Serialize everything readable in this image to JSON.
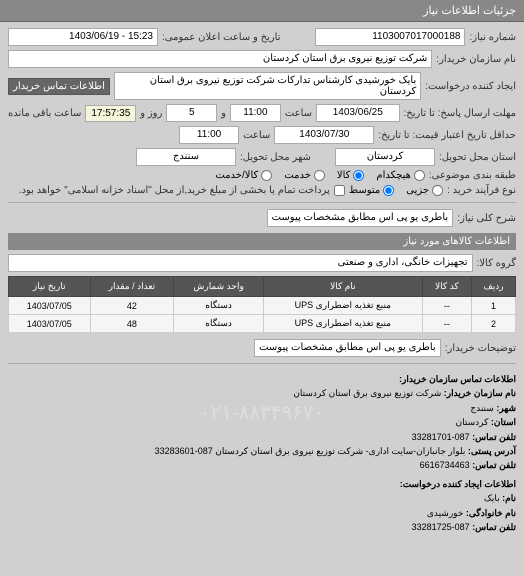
{
  "header": {
    "title": "جزئیات اطلاعات نیاز"
  },
  "fields": {
    "request_number_label": "شماره نیاز:",
    "request_number": "1103007017000188",
    "public_datetime_label": "تاریخ و ساعت اعلان عمومی:",
    "public_datetime": "15:23 - 1403/06/19",
    "buyer_name_label": "نام سازمان خریدار:",
    "buyer_name": "شرکت توزیع نیروی برق استان کردستان",
    "request_creator_label": "ایجاد کننده درخواست:",
    "request_creator": "بایک خورشیدی کارشناس تدارکات شرکت توزیع نیروی برق استان کردستان",
    "buyer_contact_btn": "اطلاعات تماس خریدار",
    "response_deadline_label": "مهلت ارسال پاسخ: تا تاریخ:",
    "response_date": "1403/06/25",
    "response_time_label": "ساعت",
    "response_time": "11:00",
    "remaining_label": "و",
    "remaining_days": "5",
    "remaining_days_label": "روز و",
    "remaining_time": "17:57:35",
    "remaining_time_label": "ساعت باقی مانده",
    "credit_deadline_label": "حداقل تاریخ اعتبار قیمت: تا تاریخ:",
    "credit_date": "1403/07/30",
    "credit_time_label": "ساعت",
    "credit_time": "11:00",
    "province_label": "استان محل تحویل:",
    "province": "کردستان",
    "city_label": "شهر محل تحویل:",
    "city": "سنندج",
    "classification_label": "طبقه بندی موضوعی:",
    "classification_none": "هیچکدام",
    "classification_goods": "کالا",
    "classification_service": "خدمت",
    "classification_goods_service": "کالا/خدمت",
    "process_type_label": "نوع فرآیند خرید :",
    "process_small": "جزیی",
    "process_medium": "متوسط",
    "process_note": "پرداخت تمام یا بخشی از مبلغ خرید,از محل \"اسناد خزانه اسلامی\" خواهد بود.",
    "general_desc_label": "شرح کلی نیاز:",
    "general_desc": "باطری یو پی اس مطابق مشخصات پیوست",
    "goods_info_title": "اطلاعات کالاهای مورد نیاز",
    "goods_group_label": "گروه کالا:",
    "goods_group": "تجهیزات خانگی، اداری و صنعتی",
    "buyer_note_label": "توضیحات خریدار:",
    "buyer_note": "باطری یو پی اس مطابق مشخصات پیوست"
  },
  "table": {
    "headers": {
      "row": "ردیف",
      "code": "کد کالا",
      "name": "نام کالا",
      "unit": "واحد شمارش",
      "qty": "تعداد / مقدار",
      "date": "تاریخ نیاز"
    },
    "rows": [
      {
        "row": "1",
        "code": "--",
        "name": "منبع تغذیه اضطراری UPS",
        "unit": "دستگاه",
        "qty": "42",
        "date": "1403/07/05"
      },
      {
        "row": "2",
        "code": "--",
        "name": "منبع تغذیه اضطراری UPS",
        "unit": "دستگاه",
        "qty": "48",
        "date": "1403/07/05"
      }
    ]
  },
  "contact": {
    "section1_title": "اطلاعات تماس سازمان خریدار:",
    "org_label": "نام سازمان خریدار:",
    "org_value": "شرکت توزیع نیروی برق استان کردستان",
    "city_label": "شهر:",
    "city_value": "سنندج",
    "province_label": "استان:",
    "province_value": "کردستان",
    "phone_label": "تلفن تماس:",
    "phone_value": "087-33281701",
    "address_label": "آدرس پستی:",
    "address_value": "بلوار جانبازان-سایت اداری- شرکت توزیع نیروی برق استان کردستان 087-33283601",
    "fax_label": "تلفن تماس:",
    "fax_value": "6616734463",
    "section2_title": "اطلاعات ایجاد کننده درخواست:",
    "name_label": "نام:",
    "name_value": "بایک",
    "lastname_label": "نام خانوادگی:",
    "lastname_value": "خورشیدی",
    "phone2_label": "تلفن تماس:",
    "phone2_value": "087-33281725"
  },
  "watermark": "۰۲۱-۸۸۳۴۹۶۷۰"
}
